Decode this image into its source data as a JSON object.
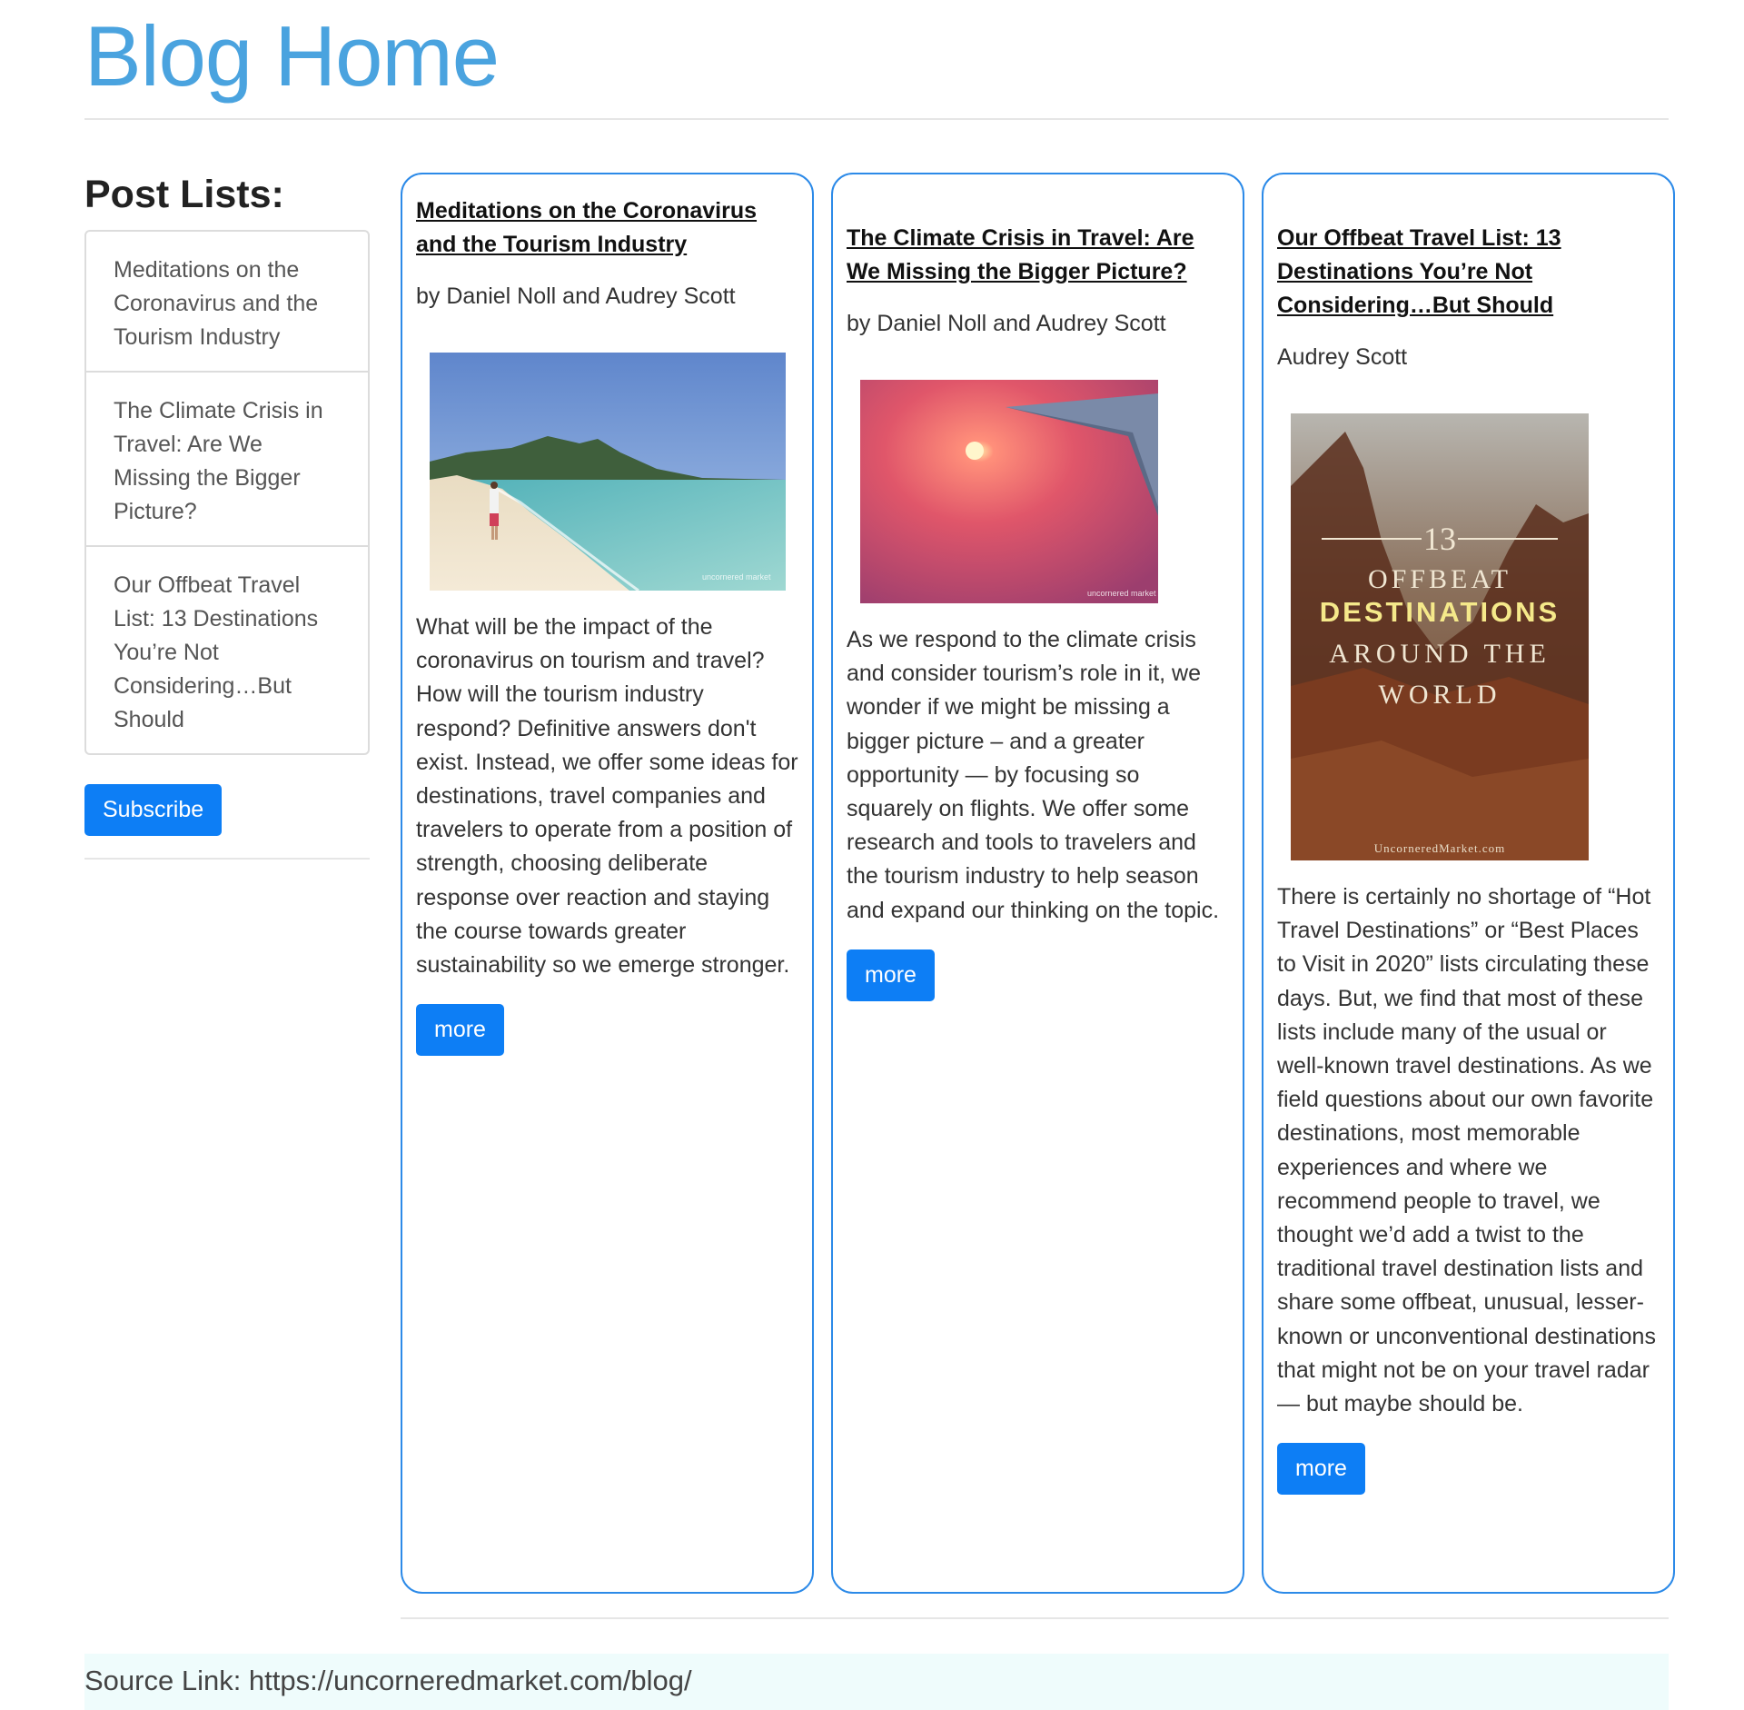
{
  "header": {
    "title": "Blog Home"
  },
  "sidebar": {
    "heading": "Post Lists:",
    "items": [
      {
        "label": "Meditations on the Coronavirus and the Tourism Industry"
      },
      {
        "label": "The Climate Crisis in Travel: Are We Missing the Bigger Picture?"
      },
      {
        "label": "Our Offbeat Travel List: 13 Destinations You’re Not Considering…But Should"
      }
    ],
    "subscribe_label": "Subscribe"
  },
  "cards": [
    {
      "title": "Meditations on the Coronavirus and the Tourism Industry",
      "author": "by Daniel Noll and Audrey Scott",
      "image": "beach-photo",
      "image_watermark": "uncornered market",
      "description": "What will be the impact of the coronavirus on tourism and travel? How will the tourism industry respond? Definitive answers don't exist. Instead, we offer some ideas for destinations, travel companies and travelers to operate from a position of strength, choosing deliberate response over reaction and staying the course towards greater sustainability so we emerge stronger.",
      "more_label": "more"
    },
    {
      "title": "The Climate Crisis in Travel: Are We Missing the Bigger Picture?",
      "author": "by Daniel Noll and Audrey Scott",
      "image": "airplane-wing-sunset-photo",
      "image_watermark": "uncornered market",
      "description": "As we respond to the climate crisis and consider tourism’s role in it, we wonder if we might be missing a bigger picture – and a greater opportunity — by focusing so squarely on flights. We offer some research and tools to travelers and the tourism industry to help season and expand our thinking on the topic.",
      "more_label": "more"
    },
    {
      "title": "Our Offbeat Travel List: 13 Destinations You’re Not Considering…But Should",
      "author": "Audrey Scott",
      "image": "canyon-poster-photo",
      "poster": {
        "number": "13",
        "line1": "OFFBEAT",
        "line2": "DESTINATIONS",
        "line3": "AROUND THE",
        "line4": "WORLD",
        "footer": "UncorneredMarket.com"
      },
      "description": "There is certainly no shortage of “Hot Travel Destinations” or “Best Places to Visit in 2020” lists circulating these days. But, we find that most of these lists include many of the usual or well-known travel destinations. As we field questions about our own favorite destinations, most memorable experiences and where we recommend people to travel, we thought we’d add a twist to the traditional travel destination lists and share some offbeat, unusual, lesser-known or unconventional destinations that might not be on your travel radar — but maybe should be.",
      "more_label": "more"
    }
  ],
  "footer": {
    "source": "Source Link: https://uncorneredmarket.com/blog/"
  },
  "colors": {
    "accent": "#0d7ef5",
    "title": "#4aa3df",
    "card_border": "#2c8ae8",
    "footer_bg": "#effcfc"
  }
}
